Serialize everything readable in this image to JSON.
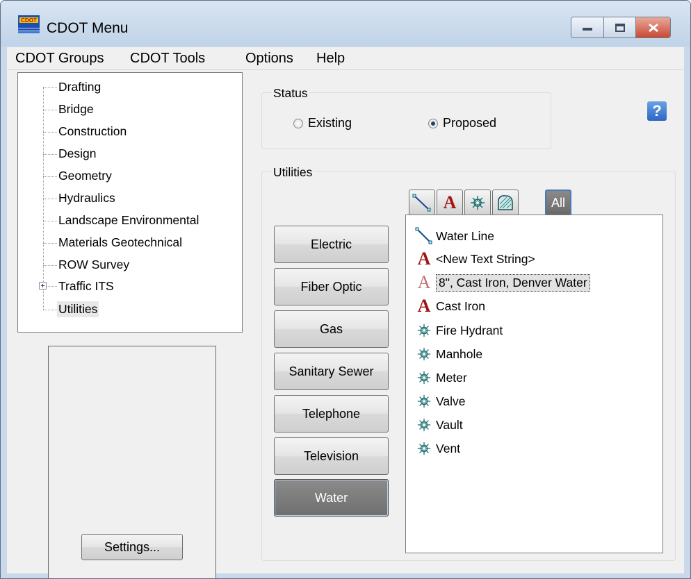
{
  "window": {
    "title": "CDOT Menu"
  },
  "menubar": {
    "items": [
      "CDOT Groups",
      "CDOT Tools",
      "Options",
      "Help"
    ]
  },
  "tree": {
    "items": [
      "Drafting",
      "Bridge",
      "Construction",
      "Design",
      "Geometry",
      "Hydraulics",
      "Landscape Environmental",
      "Materials Geotechnical",
      "ROW Survey",
      "Traffic ITS",
      "Utilities"
    ],
    "selected": "Utilities"
  },
  "settings_label": "Settings...",
  "status": {
    "label": "Status",
    "options": [
      "Existing",
      "Proposed"
    ],
    "selected": "Proposed"
  },
  "help_label": "?",
  "utilities": {
    "label": "Utilities",
    "filter_all_label": "All",
    "buttons": [
      "Electric",
      "Fiber Optic",
      "Gas",
      "Sanitary Sewer",
      "Telephone",
      "Television",
      "Water"
    ],
    "active": "Water"
  },
  "list": {
    "items": [
      {
        "label": "Water Line",
        "icon": "line-icon"
      },
      {
        "label": "<New Text String>",
        "icon": "text-icon"
      },
      {
        "label": "8\", Cast Iron, Denver Water",
        "icon": "text-icon"
      },
      {
        "label": "Cast Iron",
        "icon": "text-icon"
      },
      {
        "label": "Fire Hydrant",
        "icon": "cell-icon"
      },
      {
        "label": "Manhole",
        "icon": "cell-icon"
      },
      {
        "label": "Meter",
        "icon": "cell-icon"
      },
      {
        "label": "Valve",
        "icon": "cell-icon"
      },
      {
        "label": "Vault",
        "icon": "cell-icon"
      },
      {
        "label": "Vent",
        "icon": "cell-icon"
      }
    ],
    "selected_index": 2
  },
  "colors": {
    "accent": "#1d3f71",
    "active_button": "#7a7a7a",
    "text_icon": "#a01414",
    "cell_icon": "#1a6e6e"
  }
}
